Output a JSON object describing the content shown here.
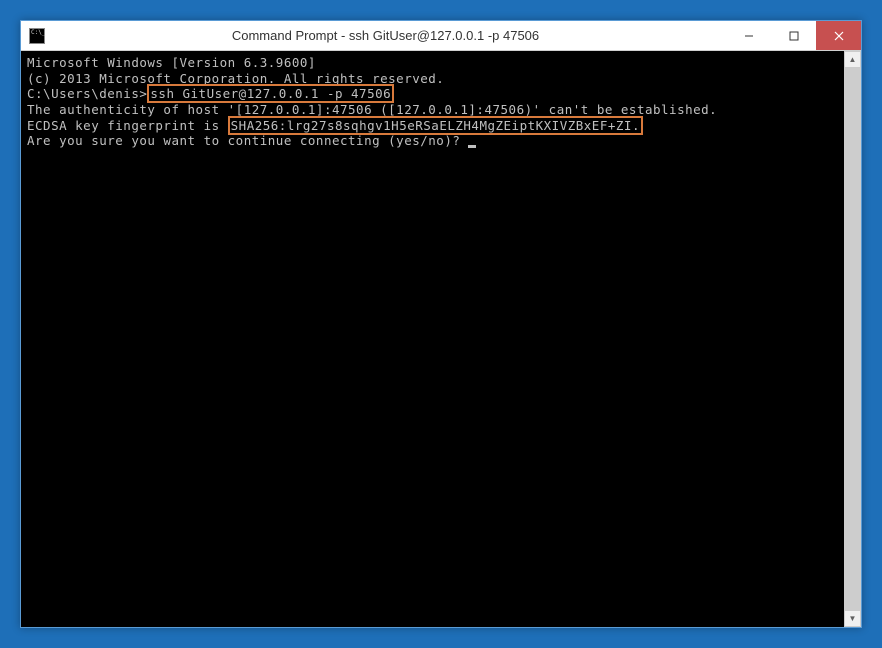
{
  "window": {
    "title": "Command Prompt - ssh  GitUser@127.0.0.1 -p 47506"
  },
  "console": {
    "line1": "Microsoft Windows [Version 6.3.9600]",
    "line2": "(c) 2013 Microsoft Corporation. All rights reserved.",
    "blank1": "",
    "prompt_prefix": "C:\\Users\\denis>",
    "highlighted_cmd": "ssh GitUser@127.0.0.1 -p 47506",
    "auth_line": "The authenticity of host '[127.0.0.1]:47506 ([127.0.0.1]:47506)' can't be established.",
    "fingerprint_prefix": "ECDSA key fingerprint is ",
    "highlighted_fingerprint": "SHA256:lrg27s8sqhgv1H5eRSaELZH4MgZEiptKXIVZBxEF+ZI.",
    "confirm_line": "Are you sure you want to continue connecting (yes/no)? "
  }
}
